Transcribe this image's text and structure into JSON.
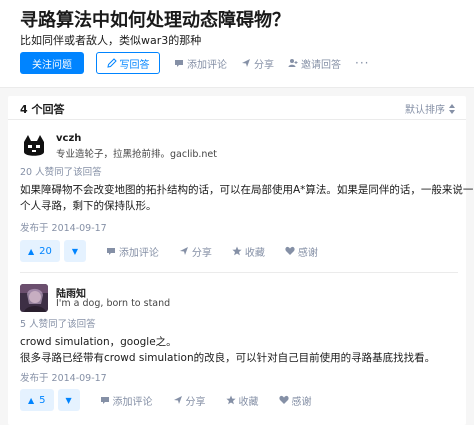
{
  "question": {
    "title": "寻路算法中如何处理动态障碍物？",
    "detail": "比如同伴或者敌人，类似war3的那种",
    "follow_label": "关注问题",
    "write_label": "写回答",
    "comment_label": "添加评论",
    "share_label": "分享",
    "invite_label": "邀请回答",
    "more_label": "···"
  },
  "answers_header": {
    "count_label": "4 个回答",
    "sort_label": "默认排序"
  },
  "answers": [
    {
      "author": "vczh",
      "bio": "专业造轮子，拉黑抢前排。gaclib.net",
      "voters": "20 人赞同了该回答",
      "content": [
        "如果障碍物不会改变地图的拓扑结构的话，可以在局部使用A*算法。如果是同伴的话，一般来说一",
        "个人寻路，剩下的保持队形。"
      ],
      "date": "发布于 2014-09-17",
      "vote_count": "20",
      "comment_label": "添加评论",
      "share_label": "分享",
      "favorite_label": "收藏",
      "thanks_label": "感谢"
    },
    {
      "author": "陆雨知",
      "bio": "I'm a dog, born to stand",
      "voters": "5 人赞同了该回答",
      "content": [
        "crowd simulation，google之。",
        "很多寻路已经带有crowd simulation的改良，可以针对自己目前使用的寻路基底找找看。"
      ],
      "date": "发布于 2014-09-17",
      "vote_count": "5",
      "comment_label": "添加评论",
      "share_label": "分享",
      "favorite_label": "收藏",
      "thanks_label": "感谢"
    }
  ],
  "colors": {
    "brand": "#0084ff",
    "muted": "#8590a6",
    "vote_bg": "#e5f2ff"
  }
}
